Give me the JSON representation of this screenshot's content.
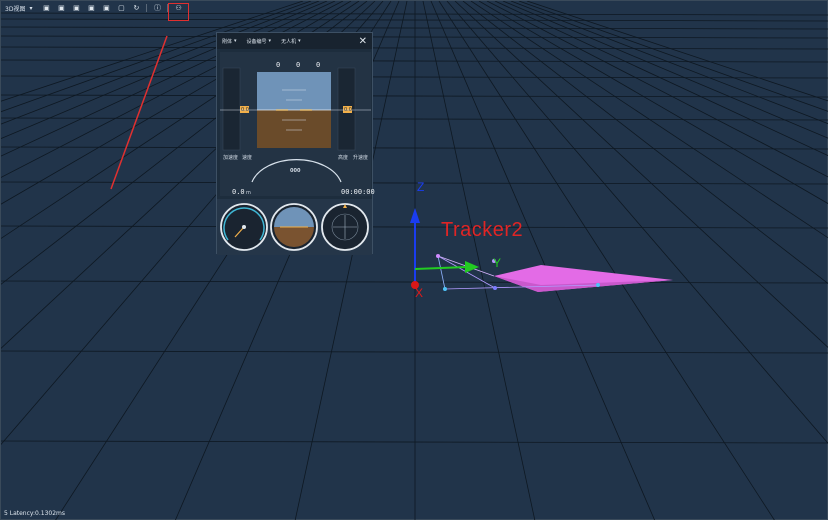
{
  "toolbar": {
    "view_select": "3D视图",
    "view_dropdown_icon": "caret-down",
    "buttons": [
      "cube-front-icon",
      "cube-back-icon",
      "cube-left-icon",
      "cube-right-icon",
      "cube-top-icon",
      "cube-bottom-icon",
      "refresh-icon",
      "info-icon",
      "drone-icon"
    ]
  },
  "scene": {
    "tracker_label": "Tracker2",
    "axis_z": "Z",
    "axis_y": "Y",
    "axis_x": "X",
    "colors": {
      "background": "#21344a",
      "grid": "#0e1822",
      "drone": "#e36be6",
      "axis_z": "#1a3cf0",
      "axis_y": "#22cc22",
      "axis_x": "#e01a1a",
      "highlight": "#e03030"
    }
  },
  "panel": {
    "dropdown_1": "刚体",
    "dropdown_2": "设备编号",
    "dropdown_3": "无人机",
    "close_icon": "close-icon",
    "pfd": {
      "heading_values": [
        "0",
        "0",
        "0"
      ],
      "left_tape_value": "0.0",
      "right_tape_value": "0.0",
      "left_label_1": "加速度",
      "left_label_2": "速度",
      "right_label_1": "高度",
      "right_label_2": "升速度",
      "bottom_left_value": "0.0",
      "bottom_left_unit": "m",
      "bottom_left_label": "距离",
      "bottom_right_value": "00:00:00",
      "bottom_right_label": "时间",
      "arc_value": "000",
      "arc_ticks": [
        "5",
        "10",
        "15",
        "20",
        "25",
        "30"
      ]
    },
    "gauges": [
      "airspeed-gauge",
      "attitude-gauge",
      "heading-gauge"
    ]
  },
  "status": {
    "latency_text": "5 Latency:0.1302ms"
  }
}
